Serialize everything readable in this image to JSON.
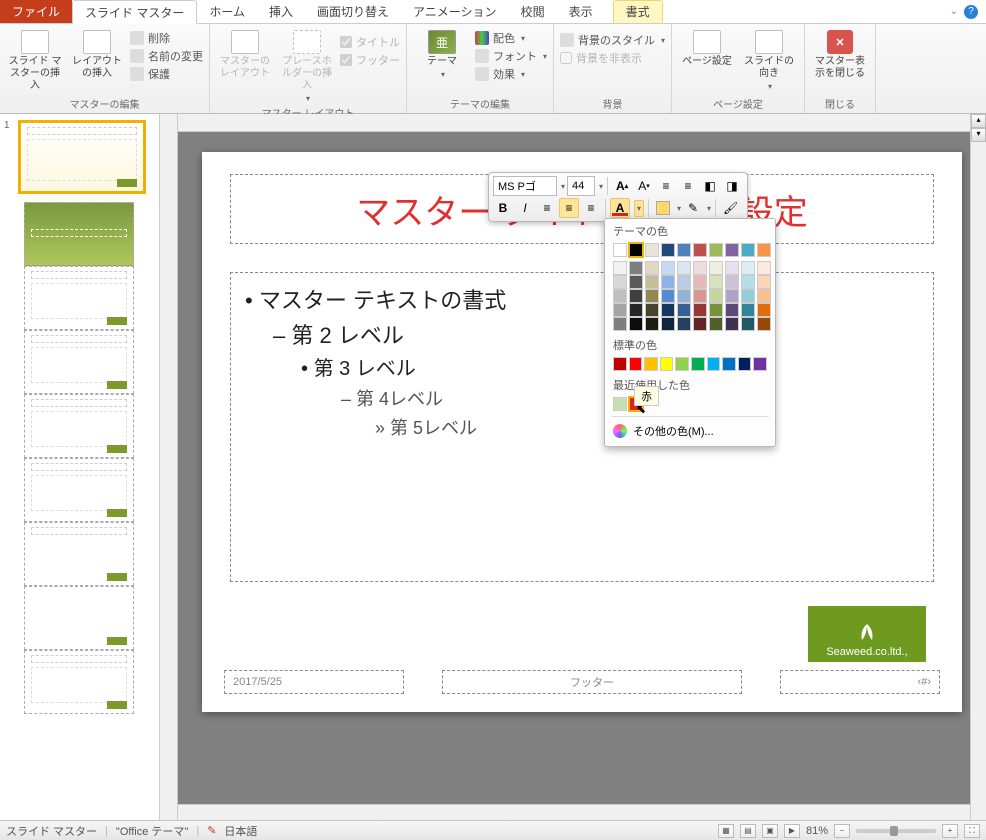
{
  "tabs": {
    "file": "ファイル",
    "slideMaster": "スライド マスター",
    "home": "ホーム",
    "insert": "挿入",
    "transition": "画面切り替え",
    "animation": "アニメーション",
    "review": "校閲",
    "view": "表示",
    "format": "書式"
  },
  "ribbon": {
    "g1": {
      "label": "マスターの編集",
      "insertMaster": "スライド マスターの挿入",
      "insertLayout": "レイアウトの挿入",
      "delete": "削除",
      "rename": "名前の変更",
      "preserve": "保護"
    },
    "g2": {
      "label": "マスター レイアウト",
      "masterLayout": "マスターのレイアウト",
      "insertPH": "プレースホルダーの挿入",
      "title": "タイトル",
      "footer": "フッター"
    },
    "g3": {
      "label": "テーマの編集",
      "theme": "テーマ",
      "colors": "配色",
      "fonts": "フォント",
      "effects": "効果"
    },
    "g4": {
      "label": "背景",
      "bgStyle": "背景のスタイル",
      "hideGraphics": "背景を非表示"
    },
    "g5": {
      "label": "ページ設定",
      "pageSetup": "ページ設定",
      "orientation": "スライドの向き"
    },
    "g6": {
      "label": "閉じる",
      "close": "マスター表示を閉じる"
    }
  },
  "slide": {
    "title": "マスター タイトル",
    "titleSuffix": "設定",
    "lv1": "マスター テキストの書式",
    "lv2": "第 2 レベル",
    "lv3": "第 3 レベル",
    "lv4": "第 4レベル",
    "lv5": "第 5レベル",
    "date": "2017/5/25",
    "footer": "フッター",
    "pageNum": "‹#›",
    "logo": "Seaweed.co.ltd.,"
  },
  "miniToolbar": {
    "fontName": "MS Pゴ",
    "fontSize": "44"
  },
  "picker": {
    "themeColors": "テーマの色",
    "standardColors": "標準の色",
    "recentColors": "最近使用した色",
    "moreColors": "その他の色(M)...",
    "tooltip": "赤",
    "themeRow": [
      "#ffffff",
      "#000000",
      "#e8e4dc",
      "#1f497d",
      "#4f81bd",
      "#c0504d",
      "#9bbb59",
      "#8064a2",
      "#4bacc6",
      "#f79646"
    ],
    "themeTints": [
      [
        "#f2f2f2",
        "#7f7f7f",
        "#ddd9c3",
        "#c6d9f0",
        "#dbe5f1",
        "#f2dcdb",
        "#ebf1dd",
        "#e5e0ec",
        "#dbeef3",
        "#fdeada"
      ],
      [
        "#d8d8d8",
        "#595959",
        "#c4bd97",
        "#8db3e2",
        "#b8cce4",
        "#e5b9b7",
        "#d7e3bc",
        "#ccc1d9",
        "#b7dde8",
        "#fbd5b5"
      ],
      [
        "#bfbfbf",
        "#3f3f3f",
        "#938953",
        "#548dd4",
        "#95b3d7",
        "#d99694",
        "#c3d69b",
        "#b2a2c7",
        "#92cddc",
        "#fac08f"
      ],
      [
        "#a5a5a5",
        "#262626",
        "#494429",
        "#17365d",
        "#366092",
        "#953734",
        "#76923c",
        "#5f497a",
        "#31859b",
        "#e36c09"
      ],
      [
        "#7f7f7f",
        "#0c0c0c",
        "#1d1b10",
        "#0f243e",
        "#244061",
        "#632423",
        "#4f6128",
        "#3f3151",
        "#205867",
        "#974806"
      ]
    ],
    "standard": [
      "#c00000",
      "#ff0000",
      "#ffc000",
      "#ffff00",
      "#92d050",
      "#00b050",
      "#00b0f0",
      "#0070c0",
      "#002060",
      "#7030a0"
    ],
    "recent": [
      "#c6e0b4"
    ],
    "recentHighlight": "#d22"
  },
  "status": {
    "mode": "スライド マスター",
    "theme": "\"Office テーマ\"",
    "lang": "日本語",
    "zoom": "81%"
  },
  "thumbNum": "1"
}
